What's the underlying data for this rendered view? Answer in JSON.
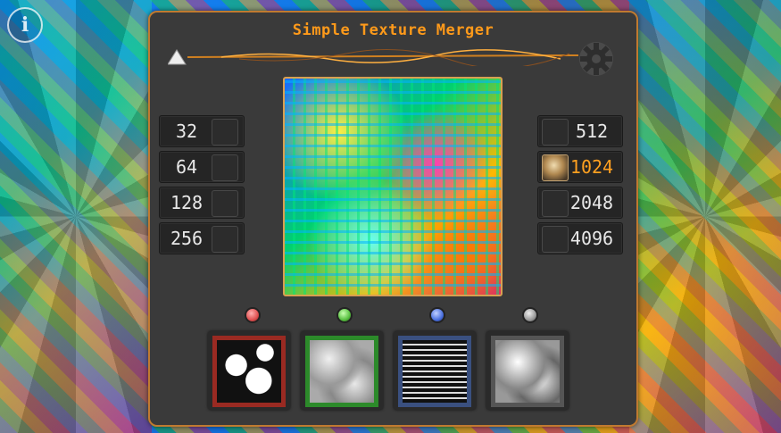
{
  "app": {
    "title": "Simple Texture Merger"
  },
  "icons": {
    "info": "info-icon",
    "settings": "gear-icon",
    "logo": "prism-logo-icon"
  },
  "colors": {
    "accent": "#ff9a1a",
    "panel": "#3a3a3a",
    "border": "#c07a30"
  },
  "info_label": "i",
  "sizes_left": [
    "32",
    "64",
    "128",
    "256"
  ],
  "sizes_right": [
    "512",
    "1024",
    "2048",
    "4096"
  ],
  "selected_size": "1024",
  "channels": [
    {
      "name": "red",
      "led": "#e05050",
      "frame": "#9a2a22"
    },
    {
      "name": "green",
      "led": "#58c040",
      "frame": "#2c8a2a"
    },
    {
      "name": "blue",
      "led": "#4a70e0",
      "frame": "#3a5080"
    },
    {
      "name": "gray",
      "led": "#9a9a9a",
      "frame": "#555555"
    }
  ]
}
